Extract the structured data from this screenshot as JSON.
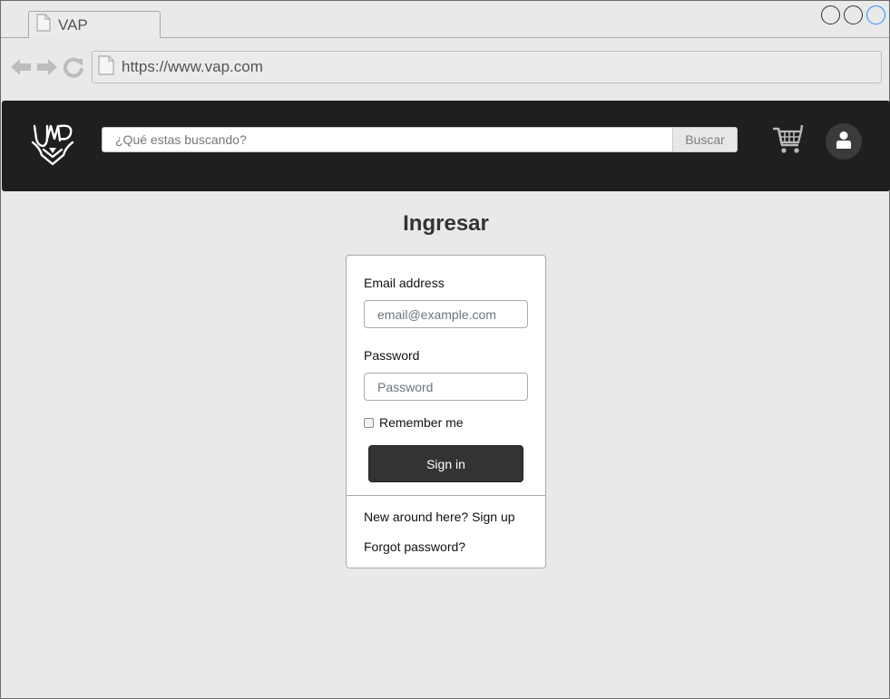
{
  "browser": {
    "tab_title": "VAP",
    "url": "https://www.vap.com",
    "icons": [
      "document-icon",
      "back-arrow-icon",
      "forward-arrow-icon",
      "reload-icon"
    ],
    "window_buttons": [
      "window-button",
      "window-button",
      "window-button-active"
    ]
  },
  "header": {
    "logo_name": "vap-logo",
    "search": {
      "placeholder": "¿Qué estas buscando?",
      "button_label": "Buscar"
    },
    "cart_icon": "cart-icon",
    "user_icon": "user-icon"
  },
  "login": {
    "title": "Ingresar",
    "email_label": "Email address",
    "email_placeholder": "email@example.com",
    "password_label": "Password",
    "password_placeholder": "Password",
    "remember_label": "Remember me",
    "signin_label": "Sign in",
    "signup_link": "New around here? Sign up",
    "forgot_link": "Forgot password?"
  },
  "colors": {
    "header_bg": "#1f1f1f",
    "button_bg": "#333333",
    "page_bg": "#e9e9e9",
    "active_window_button": "#1e90ff"
  }
}
